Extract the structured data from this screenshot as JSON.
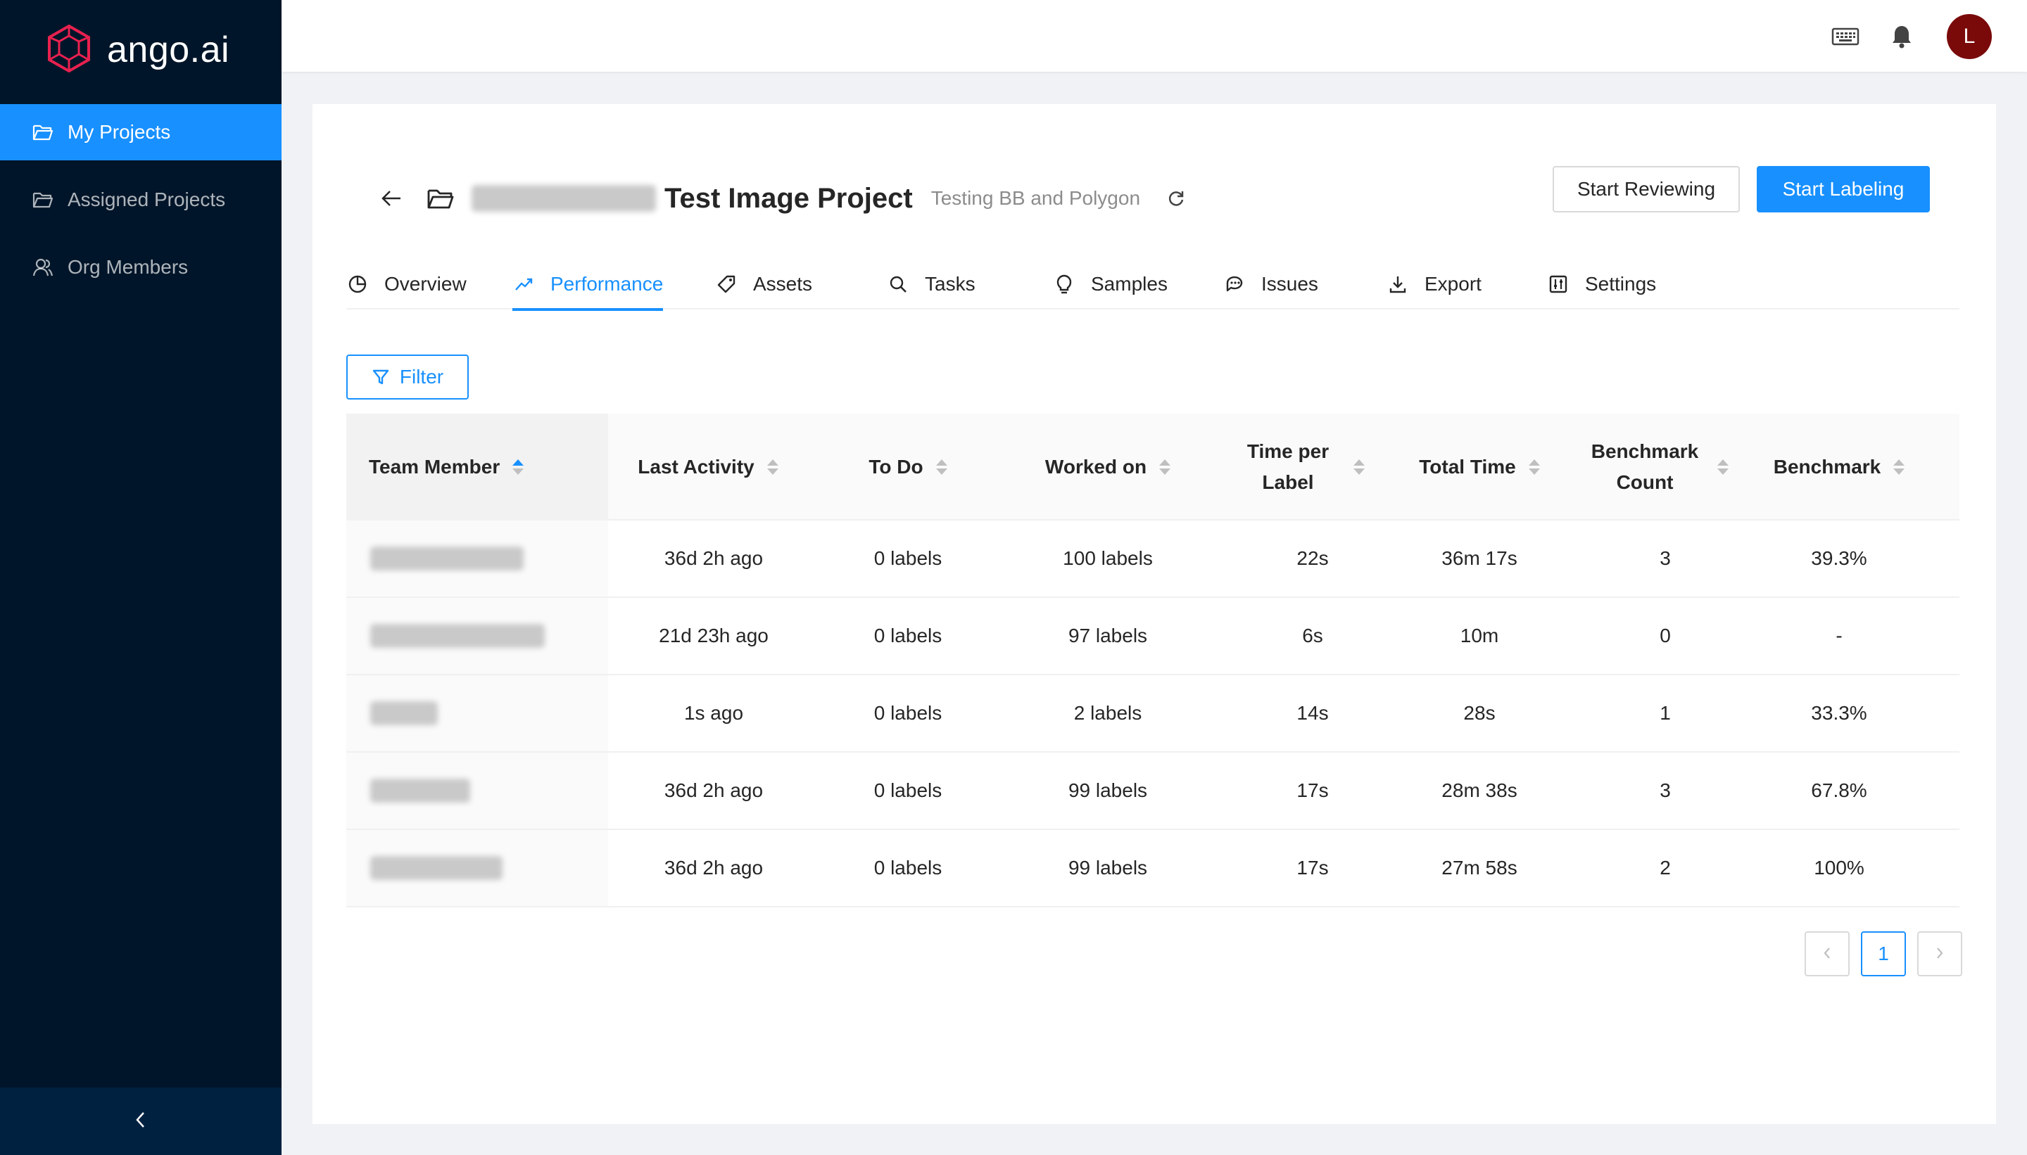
{
  "app": {
    "logo_text": "ango.ai",
    "brand_color": "#1890ff",
    "sidebar_color": "#001529"
  },
  "sidebar": {
    "items": [
      {
        "label": "My Projects",
        "icon": "folder-open-icon",
        "active": true
      },
      {
        "label": "Assigned Projects",
        "icon": "folder-open-icon",
        "active": false
      },
      {
        "label": "Org Members",
        "icon": "team-icon",
        "active": false
      }
    ],
    "collapse_icon": "chevron-left-icon"
  },
  "header": {
    "icons": [
      "keyboard-icon",
      "bell-icon"
    ],
    "avatar_initial": "L",
    "avatar_color": "#7a0a0a"
  },
  "project": {
    "title": "Test Image Project",
    "subtitle": "Testing BB and Polygon",
    "start_reviewing": "Start Reviewing",
    "start_labeling": "Start Labeling"
  },
  "tabs": [
    {
      "label": "Overview",
      "icon": "pie-chart-icon",
      "active": false
    },
    {
      "label": "Performance",
      "icon": "line-chart-icon",
      "active": true
    },
    {
      "label": "Assets",
      "icon": "tag-icon",
      "active": false
    },
    {
      "label": "Tasks",
      "icon": "search-icon",
      "active": false
    },
    {
      "label": "Samples",
      "icon": "bulb-icon",
      "active": false
    },
    {
      "label": "Issues",
      "icon": "comments-icon",
      "active": false
    },
    {
      "label": "Export",
      "icon": "download-icon",
      "active": false
    },
    {
      "label": "Settings",
      "icon": "control-icon",
      "active": false
    }
  ],
  "filter": {
    "label": "Filter"
  },
  "table": {
    "columns": [
      {
        "label": "Team Member",
        "sorted": "asc"
      },
      {
        "label": "Last Activity"
      },
      {
        "label": "To Do"
      },
      {
        "label": "Worked on"
      },
      {
        "label": "Time per Label"
      },
      {
        "label": "Total Time"
      },
      {
        "label": "Benchmark Count"
      },
      {
        "label": "Benchmark"
      }
    ],
    "rows": [
      {
        "last_activity": "36d 2h ago",
        "todo": "0 labels",
        "worked_on": "100 labels",
        "time_per_label": "22s",
        "total_time": "36m 17s",
        "benchmark_count": "3",
        "benchmark": "39.3%"
      },
      {
        "last_activity": "21d 23h ago",
        "todo": "0 labels",
        "worked_on": "97 labels",
        "time_per_label": "6s",
        "total_time": "10m",
        "benchmark_count": "0",
        "benchmark": "-"
      },
      {
        "last_activity": "1s ago",
        "todo": "0 labels",
        "worked_on": "2 labels",
        "time_per_label": "14s",
        "total_time": "28s",
        "benchmark_count": "1",
        "benchmark": "33.3%"
      },
      {
        "last_activity": "36d 2h ago",
        "todo": "0 labels",
        "worked_on": "99 labels",
        "time_per_label": "17s",
        "total_time": "28m 38s",
        "benchmark_count": "3",
        "benchmark": "67.8%"
      },
      {
        "last_activity": "36d 2h ago",
        "todo": "0 labels",
        "worked_on": "99 labels",
        "time_per_label": "17s",
        "total_time": "27m 58s",
        "benchmark_count": "2",
        "benchmark": "100%"
      }
    ]
  },
  "pagination": {
    "current_page": "1"
  }
}
